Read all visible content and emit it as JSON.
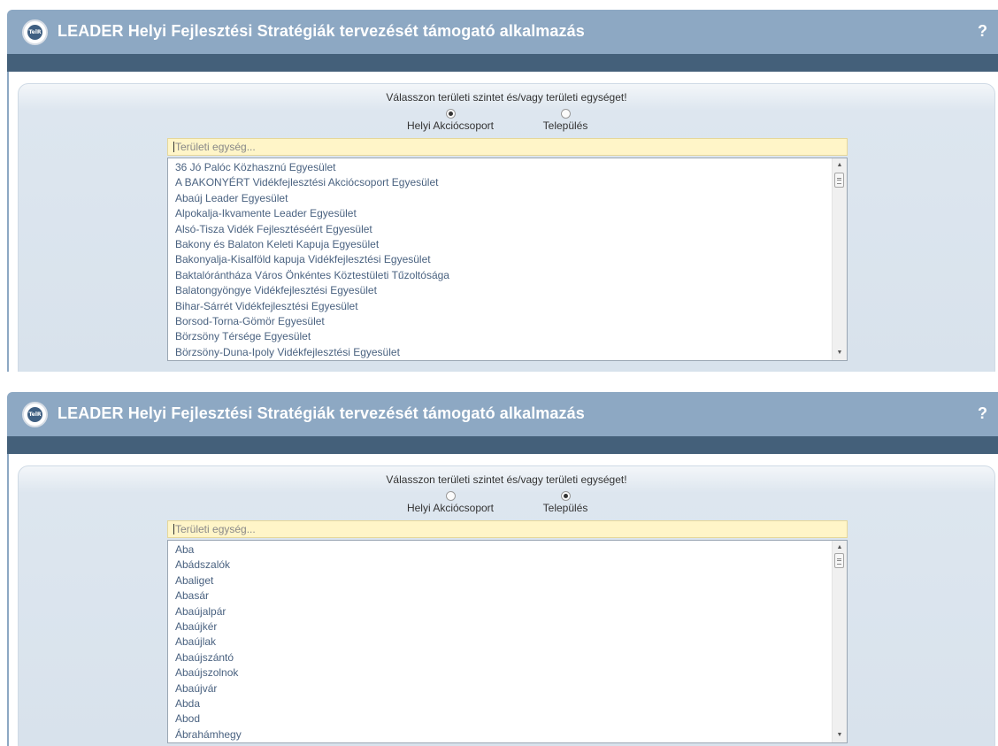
{
  "app": {
    "title": "LEADER Helyi Fejlesztési Stratégiák tervezését támogató alkalmazás",
    "help_label": "?",
    "logo_text": "TelR"
  },
  "colors": {
    "header_bg": "#8da8c3",
    "subbar_bg": "#44607a",
    "search_bg": "#fff5c8",
    "item_text": "#4a6280"
  },
  "screens": [
    {
      "prompt": "Válasszon területi szintet és/vagy területi egységet!",
      "radio_options": [
        {
          "label": "Helyi Akciócsoport",
          "selected": true
        },
        {
          "label": "Település",
          "selected": false
        }
      ],
      "search_placeholder": "Területi egység...",
      "items": [
        "36 Jó Palóc Közhasznú Egyesület",
        "A BAKONYÉRT Vidékfejlesztési Akciócsoport Egyesület",
        "Abaúj Leader Egyesület",
        "Alpokalja-Ikvamente Leader Egyesület",
        "Alsó-Tisza Vidék Fejlesztéséért Egyesület",
        "Bakony és Balaton Keleti Kapuja Egyesület",
        "Bakonyalja-Kisalföld kapuja Vidékfejlesztési Egyesület",
        "Baktalórántháza Város Önkéntes Köztestületi Tűzoltósága",
        "Balatongyöngye Vidékfejlesztési Egyesület",
        "Bihar-Sárrét Vidékfejlesztési Egyesület",
        "Borsod-Torna-Gömör Egyesület",
        "Börzsöny Térsége Egyesület",
        "Börzsöny-Duna-Ipoly Vidékfejlesztési Egyesület"
      ]
    },
    {
      "prompt": "Válasszon területi szintet és/vagy területi egységet!",
      "radio_options": [
        {
          "label": "Helyi Akciócsoport",
          "selected": false
        },
        {
          "label": "Település",
          "selected": true
        }
      ],
      "search_placeholder": "Területi egység...",
      "items": [
        "Aba",
        "Abádszalók",
        "Abaliget",
        "Abasár",
        "Abaújalpár",
        "Abaújkér",
        "Abaújlak",
        "Abaújszántó",
        "Abaújszolnok",
        "Abaújvár",
        "Abda",
        "Abod",
        "Ábrahámhegy"
      ]
    }
  ]
}
